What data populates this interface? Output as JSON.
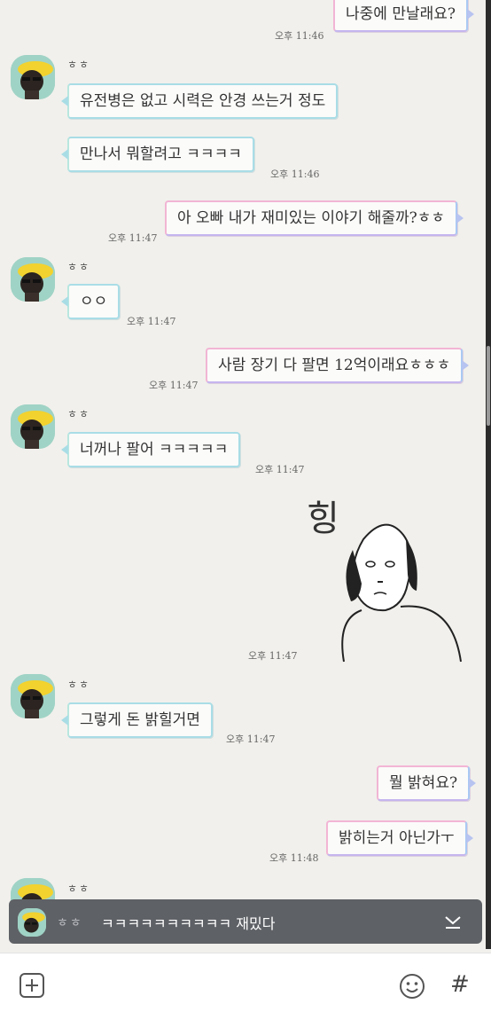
{
  "contact": {
    "name": "ㅎㅎ"
  },
  "messages": [
    {
      "text": "나중에 만날래요?",
      "time": "오후 11:46"
    },
    {
      "text": "유전병은 없고 시력은 안경 쓰는거 정도"
    },
    {
      "text": "만나서 뭐할려고 ㅋㅋㅋㅋ",
      "time": "오후 11:46"
    },
    {
      "text": "아 오빠 내가 재미있는 이야기 해줄까?ㅎㅎ",
      "time": "오후 11:47"
    },
    {
      "text": "ㅇㅇ",
      "time": "오후 11:47"
    },
    {
      "text": "사람 장기 다 팔면 12억이래요ㅎㅎㅎ",
      "time": "오후 11:47"
    },
    {
      "text": "너꺼나 팔어 ㅋㅋㅋㅋㅋ",
      "time": "오후 11:47"
    },
    {
      "sticker_text": "힝",
      "time": "오후 11:47"
    },
    {
      "text": "그렇게 돈 밝힐거면",
      "time": "오후 11:47"
    },
    {
      "text": "뭘 밝혀요?"
    },
    {
      "text": "밝히는거 아닌가ㅜ",
      "time": "오후 11:48"
    }
  ],
  "notification": {
    "sender": "ㅎㅎ",
    "preview": "ㅋㅋㅋㅋㅋㅋㅋㅋㅋㅋ 재밌다"
  },
  "icons": {
    "plus": "plus-icon",
    "emoji": "emoji-icon",
    "hash": "#",
    "collapse": "chevron-down-icon"
  },
  "colors": {
    "background": "#f1f0ec",
    "outgoing_border": "#f2b5d4",
    "incoming_border": "#a9dde6",
    "avatar_bg": "#9fd3c5",
    "notification_bg": "#5e6166"
  }
}
